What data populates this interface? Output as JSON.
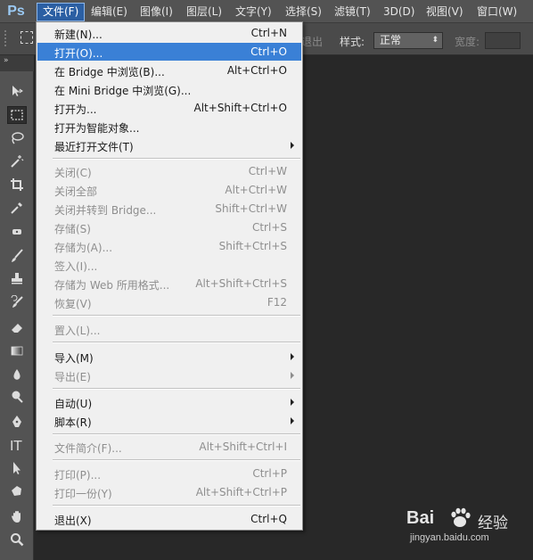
{
  "app": {
    "logo": "Ps"
  },
  "menubar": {
    "items": [
      {
        "label": "文件(F)",
        "active": true
      },
      {
        "label": "编辑(E)"
      },
      {
        "label": "图像(I)"
      },
      {
        "label": "图层(L)"
      },
      {
        "label": "文字(Y)"
      },
      {
        "label": "选择(S)"
      },
      {
        "label": "滤镜(T)"
      },
      {
        "label": "3D(D)"
      },
      {
        "label": "视图(V)"
      },
      {
        "label": "窗口(W)"
      }
    ]
  },
  "options": {
    "partial_label": "退出",
    "style_label": "样式:",
    "style_value": "正常",
    "width_label": "宽度:"
  },
  "file_menu": {
    "items": [
      {
        "label": "新建(N)...",
        "shortcut": "Ctrl+N"
      },
      {
        "label": "打开(O)...",
        "shortcut": "Ctrl+O",
        "highlighted": true
      },
      {
        "label": "在 Bridge 中浏览(B)...",
        "shortcut": "Alt+Ctrl+O"
      },
      {
        "label": "在 Mini Bridge 中浏览(G)...",
        "shortcut": ""
      },
      {
        "label": "打开为...",
        "shortcut": "Alt+Shift+Ctrl+O"
      },
      {
        "label": "打开为智能对象...",
        "shortcut": ""
      },
      {
        "label": "最近打开文件(T)",
        "shortcut": "",
        "submenu": true
      },
      {
        "label": "关闭(C)",
        "shortcut": "Ctrl+W",
        "disabled": true
      },
      {
        "label": "关闭全部",
        "shortcut": "Alt+Ctrl+W",
        "disabled": true
      },
      {
        "label": "关闭并转到 Bridge...",
        "shortcut": "Shift+Ctrl+W",
        "disabled": true
      },
      {
        "label": "存储(S)",
        "shortcut": "Ctrl+S",
        "disabled": true
      },
      {
        "label": "存储为(A)...",
        "shortcut": "Shift+Ctrl+S",
        "disabled": true
      },
      {
        "label": "签入(I)...",
        "shortcut": "",
        "disabled": true
      },
      {
        "label": "存储为 Web 所用格式...",
        "shortcut": "Alt+Shift+Ctrl+S",
        "disabled": true
      },
      {
        "label": "恢复(V)",
        "shortcut": "F12",
        "disabled": true
      },
      {
        "label": "置入(L)...",
        "shortcut": "",
        "disabled": true
      },
      {
        "label": "导入(M)",
        "shortcut": "",
        "submenu": true
      },
      {
        "label": "导出(E)",
        "shortcut": "",
        "submenu": true,
        "disabled": true
      },
      {
        "label": "自动(U)",
        "shortcut": "",
        "submenu": true
      },
      {
        "label": "脚本(R)",
        "shortcut": "",
        "submenu": true
      },
      {
        "label": "文件简介(F)...",
        "shortcut": "Alt+Shift+Ctrl+I",
        "disabled": true
      },
      {
        "label": "打印(P)...",
        "shortcut": "Ctrl+P",
        "disabled": true
      },
      {
        "label": "打印一份(Y)",
        "shortcut": "Alt+Shift+Ctrl+P",
        "disabled": true
      },
      {
        "label": "退出(X)",
        "shortcut": "Ctrl+Q"
      }
    ]
  },
  "toolbar": {
    "tools": [
      "move-tool-icon",
      "marquee-tool-icon",
      "lasso-tool-icon",
      "magic-wand-tool-icon",
      "crop-tool-icon",
      "eyedropper-tool-icon",
      "spot-healing-tool-icon",
      "brush-tool-icon",
      "clone-stamp-tool-icon",
      "history-brush-tool-icon",
      "eraser-tool-icon",
      "gradient-tool-icon",
      "blur-tool-icon",
      "dodge-tool-icon",
      "pen-tool-icon",
      "type-tool-icon",
      "path-selection-tool-icon",
      "shape-tool-icon",
      "hand-tool-icon",
      "zoom-tool-icon"
    ],
    "selected": "marquee-tool-icon"
  },
  "watermark": {
    "logo": "Bai",
    "brand": "经验",
    "url": "jingyan.baidu.com"
  },
  "colors": {
    "menu_highlight": "#3a80d6",
    "menubar_active": "#2b5fa3",
    "workspace": "#282828",
    "menu_bg": "#f0f0f0",
    "ps_logo": "#9bc9f3"
  }
}
